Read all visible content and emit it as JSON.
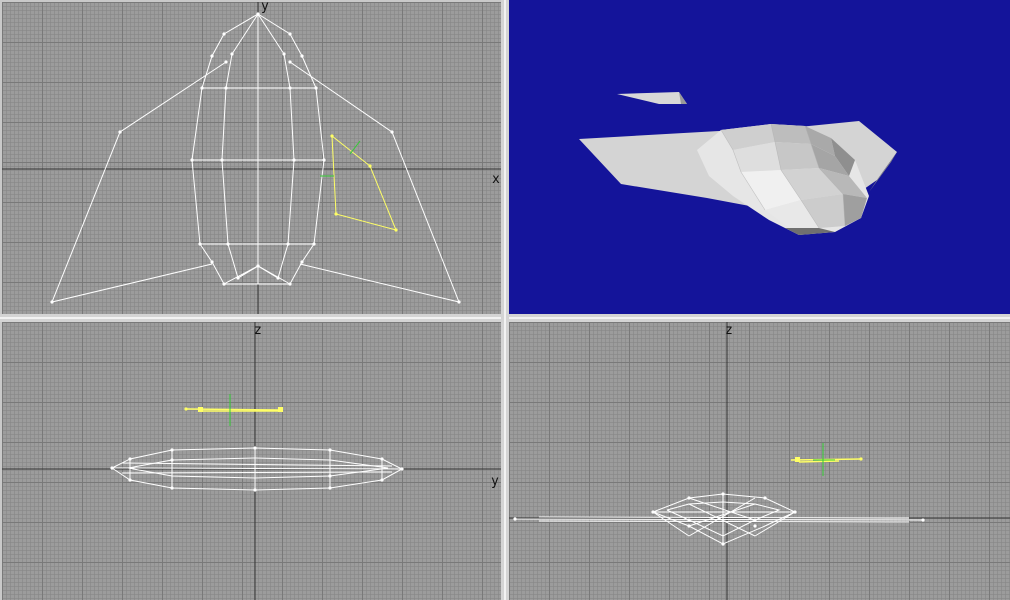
{
  "viewports": {
    "top": {
      "axis_y": "y",
      "axis_x": "x"
    },
    "front": {
      "axis_z": "z",
      "axis_y": "y"
    },
    "side": {
      "axis_z": "z"
    }
  },
  "colors": {
    "grid": "#9c9c9c",
    "wire": "#ffffff",
    "selected": "#ffff66",
    "gizmo": "#33cc33",
    "perspective_bg": "#14149a"
  }
}
